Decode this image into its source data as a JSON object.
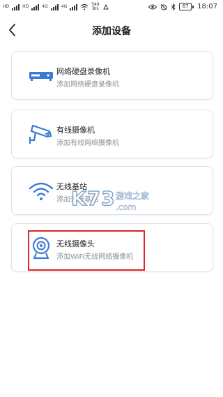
{
  "status_bar": {
    "sim1": "HD",
    "sim2": "HD",
    "net1": "4G",
    "net2": "4G",
    "speed_value": "549",
    "speed_unit": "B/s",
    "battery": "67",
    "time": "18:07"
  },
  "header": {
    "title": "添加设备"
  },
  "devices": [
    {
      "title": "网络硬盘录像机",
      "subtitle": "添加网络硬盘录像机",
      "icon": "nvr-icon"
    },
    {
      "title": "有线摄像机",
      "subtitle": "添加有线网络摄像机",
      "icon": "wired-camera-icon"
    },
    {
      "title": "无线基站",
      "subtitle": "添加无线基站",
      "icon": "wifi-icon"
    },
    {
      "title": "无线摄像头",
      "subtitle": "添加WiFi无线网络摄像机",
      "icon": "wireless-camera-icon"
    }
  ],
  "watermark": {
    "logo": "K73",
    "cn": "游戏之家",
    "domain": ".com"
  },
  "colors": {
    "accent": "#3a7bd5",
    "highlight": "#e02424",
    "card_border": "#dde3e8"
  }
}
